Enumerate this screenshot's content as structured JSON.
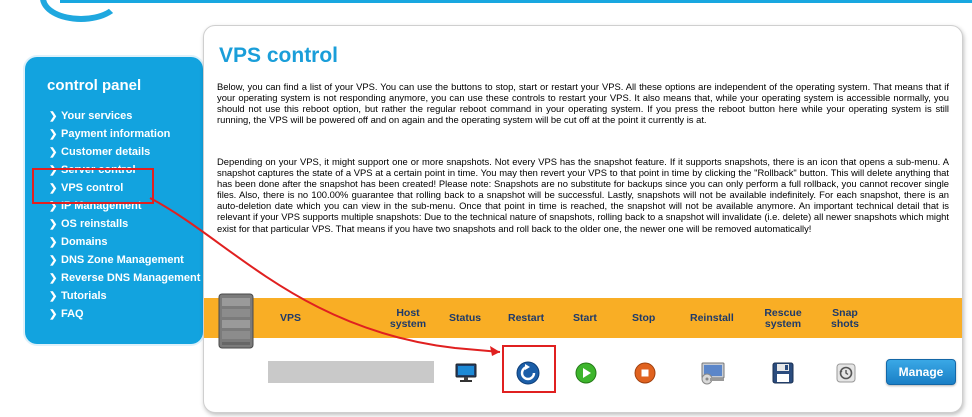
{
  "sidebar": {
    "title": "control panel",
    "items": [
      {
        "label": "Your services"
      },
      {
        "label": "Payment information"
      },
      {
        "label": "Customer details"
      },
      {
        "label": "Server control"
      },
      {
        "label": "VPS control"
      },
      {
        "label": "IP Management"
      },
      {
        "label": "OS reinstalls"
      },
      {
        "label": "Domains"
      },
      {
        "label": "DNS Zone Management"
      },
      {
        "label": "Reverse DNS Management"
      },
      {
        "label": "Tutorials"
      },
      {
        "label": "FAQ"
      }
    ]
  },
  "main": {
    "title": "VPS control",
    "paragraph1": "Below, you can find a list of your VPS. You can use the buttons to stop, start or restart your VPS. All these options are independent of the operating system. That means that if your operating system is not responding anymore, you can use these controls to restart your VPS. It also means that, while your operating system is accessible normally, you should not use this reboot option, but rather the regular reboot command in your operating system. If you press the reboot button here while your operating system is still running, the VPS will be powered off and on again and the operating system will be cut off at the point it currently is at.",
    "paragraph2": "Depending on your VPS, it might support one or more snapshots. Not every VPS has the snapshot feature. If it supports snapshots, there is an icon that opens a sub-menu. A snapshot captures the state of a VPS at a certain point in time. You may then revert your VPS to that point in time by clicking the \"Rollback\" button. This will delete anything that has been done after the snapshot has been created! Please note: Snapshots are no substitute for backups since you can only perform a full rollback, you cannot recover single files. Also, there is no 100.00% guarantee that rolling back to a snapshot will be successful. Lastly, snapshots will not be available indefinitely. For each snapshot, there is an auto-deletion date which you can view in the sub-menu. Once that point in time is reached, the snapshot will not be available anymore. An important technical detail that is relevant if your VPS supports multiple snapshots: Due to the technical nature of snapshots, rolling back to a snapshot will invalidate (i.e. delete) all newer snapshots which might exist for that particular VPS. That means if you have two snapshots and roll back to the older one, the newer one will be removed automatically!"
  },
  "table": {
    "headers": {
      "vps": "VPS",
      "host_line1": "Host",
      "host_line2": "system",
      "status": "Status",
      "restart": "Restart",
      "start": "Start",
      "stop": "Stop",
      "reinstall": "Reinstall",
      "rescue_line1": "Rescue",
      "rescue_line2": "system",
      "snap_line1": "Snap",
      "snap_line2": "shots"
    },
    "manage_label": "Manage"
  },
  "colors": {
    "accent_blue": "#12a3df",
    "header_bar": "#f9ae25",
    "annotation_red": "#e02020"
  },
  "icons": [
    "server-icon",
    "monitor-icon",
    "restart-icon",
    "play-icon",
    "stop-icon",
    "reinstall-icon",
    "save-icon",
    "snapshot-icon"
  ]
}
